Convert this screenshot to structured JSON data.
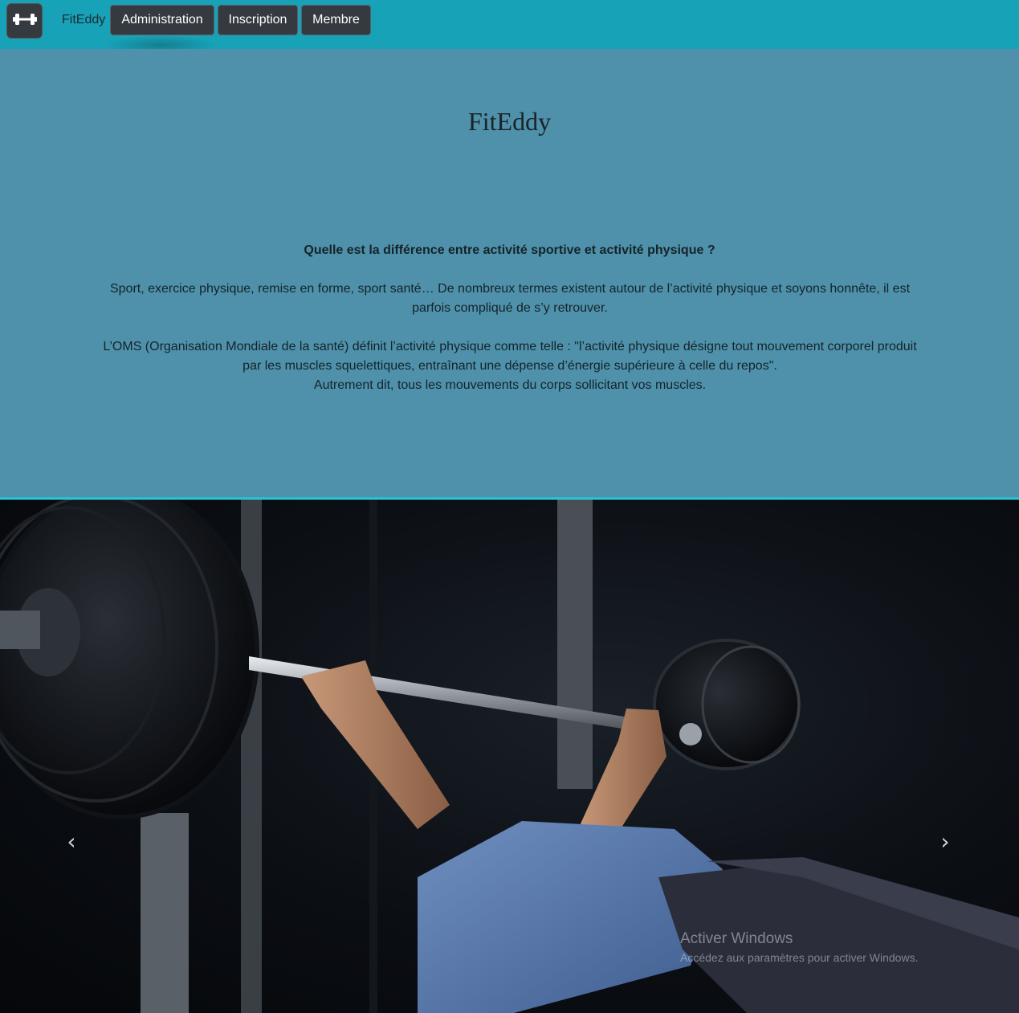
{
  "navbar": {
    "logo_icon": "dumbbell-icon",
    "brand": "FitEddy",
    "buttons": [
      "Administration",
      "Inscription",
      "Membre"
    ]
  },
  "hero": {
    "title": "FitEddy",
    "question": "Quelle est la différence entre activité sportive et activité physique ?",
    "paragraph1": "Sport, exercice physique, remise en forme, sport santé… De nombreux termes existent autour de l’activité physique et soyons honnête, il est parfois compliqué de s’y retrouver.",
    "paragraph2_line1": "L’OMS (Organisation Mondiale de la santé) définit l’activité physique comme telle : \"l’activité physique désigne tout mouvement corporel produit par les muscles squelettiques, entraînant une dépense d’énergie supérieure à celle du repos\".",
    "paragraph2_line2": "Autrement dit, tous les mouvements du corps sollicitant vos muscles."
  },
  "carousel": {
    "prev_icon": "chevron-left-icon",
    "next_icon": "chevron-right-icon"
  },
  "watermark": {
    "title": "Activer Windows",
    "subtitle": "Accédez aux paramètres pour activer Windows."
  },
  "colors": {
    "navbar": "#17a2b8",
    "hero_bg": "#4f91aa",
    "button_bg": "#343a40",
    "divider": "#28c3d4"
  }
}
